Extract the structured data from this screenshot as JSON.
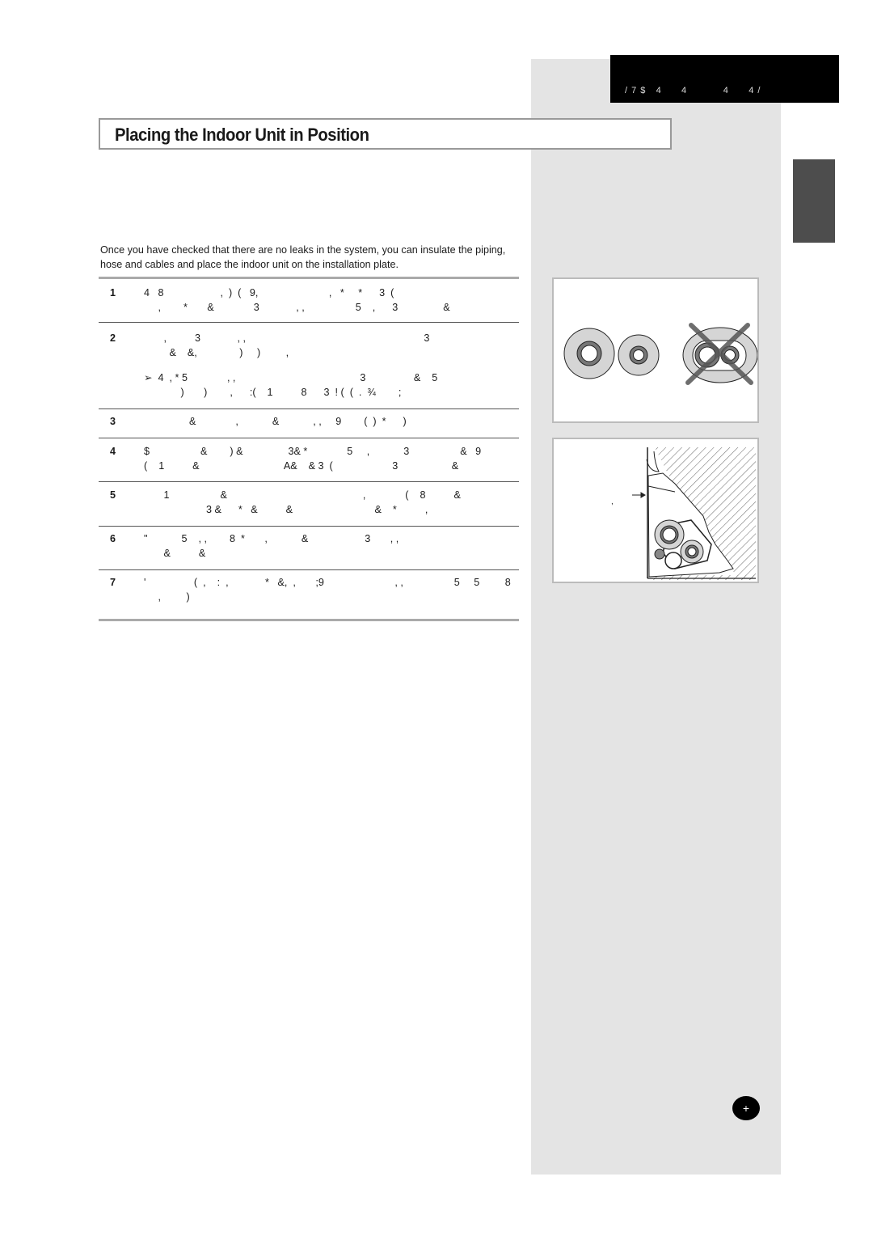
{
  "header": {
    "section_text": "/ 7 $   4      4           4      4 /"
  },
  "title": "Placing the Indoor Unit in Position",
  "intro": "Once you have checked that there are no leaks in the system, you can insulate the piping, hose and cables and place the indoor unit on the installation plate.",
  "steps": [
    {
      "num": "1",
      "lines": [
        "4   8                    ,  )  (   9,                         ,   *     *      3  (",
        "     ,        *       &              3             , ,                  5    ,      3                &"
      ]
    },
    {
      "num": "2",
      "lines": [
        "       ,          3             , ,                                                               3",
        "         &    &,               )     )         ,"
      ]
    },
    {
      "num": "2-note",
      "lines": [
        "➢  4  , * 5              , ,                                            3                 &    5",
        "             )       )        ,      :(    1          8      3  ! (  (  .  ¾        ;"
      ]
    },
    {
      "num": "3",
      "lines": [
        "                &              ,            &            , ,     9        (  )  *      )"
      ]
    },
    {
      "num": "4",
      "lines": [
        "$                  &        ) &                3& *              5     ,            3                  &   9",
        "(    1          &                              A&    & 3  (                     3                   &"
      ]
    },
    {
      "num": "5",
      "lines": [
        "       1                  &                                                ,              (    8          &",
        "                      3 &      *   &          &                             &    *          ,"
      ]
    },
    {
      "num": "6",
      "lines": [
        "\"            5    , ,        8  *       ,            &                    3       , ,",
        "       &          &"
      ]
    },
    {
      "num": "7",
      "lines": [
        "'                 (  ,    :  ,             *   &,  ,       ;9                         , ,                  5     5         8",
        "     ,         )"
      ]
    }
  ],
  "figures": {
    "pipe_insulation": {
      "label": "pipe-insulation-correct-vs-incorrect"
    },
    "unit_cross_section": {
      "callout": ","
    }
  },
  "page_badge": "+",
  "colors": {
    "header_bg": "#000000",
    "side_column": "#e4e4e4",
    "side_tab": "#4d4d4d"
  }
}
